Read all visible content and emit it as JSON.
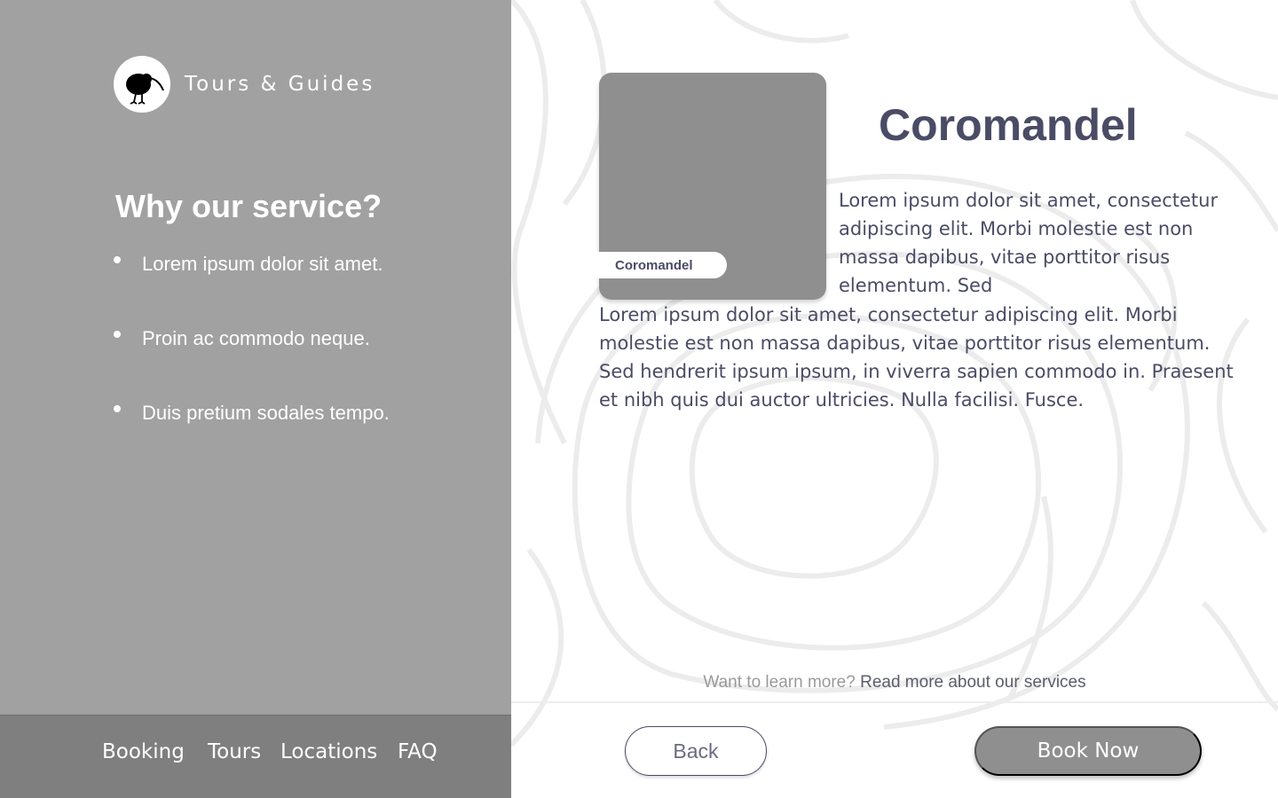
{
  "brand": {
    "name": "Tours & Guides",
    "logo_icon": "kiwi-bird-icon"
  },
  "why": {
    "title": "Why our service?",
    "items": [
      "Lorem ipsum dolor sit amet.",
      "Proin ac commodo neque.",
      "Duis pretium sodales tempo."
    ]
  },
  "nav": {
    "items": [
      "Booking",
      "Tours",
      "Locations",
      "FAQ"
    ]
  },
  "location": {
    "title": "Coromandel",
    "image_tag": "Coromandel",
    "desc_intro": "Lorem ipsum dolor sit amet, consectetur adipiscing elit. Morbi molestie est non massa dapibus, vitae porttitor risus elementum. Sed",
    "desc_main": "Lorem ipsum dolor sit amet, consectetur adipiscing elit. Morbi molestie est non massa dapibus, vitae porttitor risus elementum. Sed hendrerit ipsum ipsum, in viverra sapien commodo in. Praesent et nibh quis dui auctor ultricies. Nulla facilisi. Fusce."
  },
  "learn_more": {
    "prompt": "Want to learn more?",
    "link": "Read more about our services"
  },
  "actions": {
    "back": "Back",
    "book": "Book Now"
  },
  "colors": {
    "left_panel": "#a1a1a1",
    "nav_bar": "#807f80",
    "heading_text": "#4a4c66",
    "image_placeholder": "#8f8f8f",
    "book_button": "#8f8f8f"
  }
}
